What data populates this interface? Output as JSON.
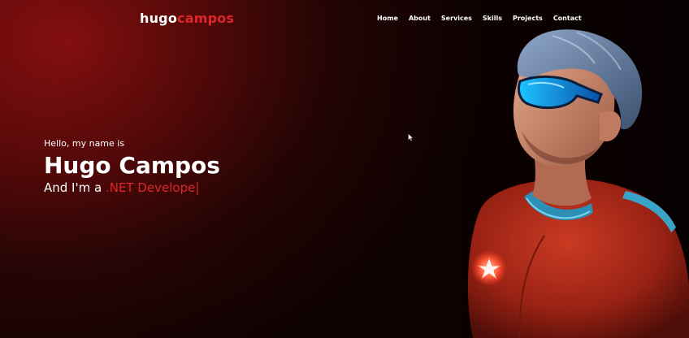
{
  "brand": {
    "first": "hugo",
    "second": "campos"
  },
  "nav": {
    "items": [
      "Home",
      "About",
      "Services",
      "Skills",
      "Projects",
      "Contact"
    ]
  },
  "hero": {
    "greeting": "Hello, my name is",
    "name": "Hugo Campos",
    "role_prefix": "And I'm a ",
    "role_typed": ".NET Develope",
    "caret": "|"
  },
  "colors": {
    "accent": "#e0262a",
    "background": "#5a0909",
    "text": "#ffffff"
  },
  "icons": {
    "cursor": "arrow-cursor-icon"
  }
}
